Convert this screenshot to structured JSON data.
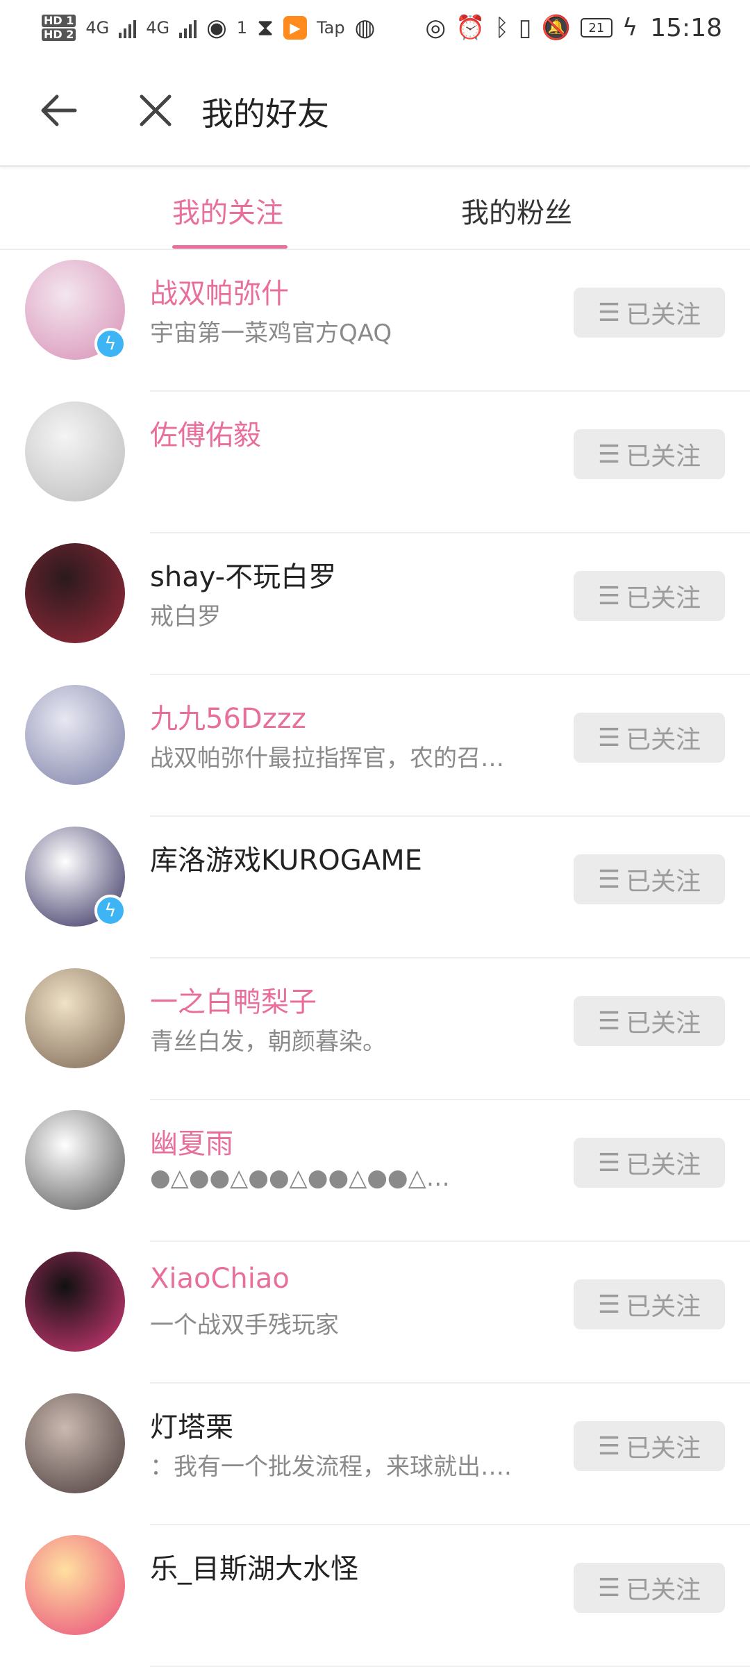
{
  "status_bar": {
    "hd1": "HD 1",
    "hd2": "HD 2",
    "net1": "4G",
    "net2": "4G",
    "wifi_num": "1",
    "tap_label": "Tap",
    "battery": "21",
    "time": "15:18"
  },
  "header": {
    "title": "我的好友"
  },
  "tabs": [
    {
      "label": "我的关注"
    },
    {
      "label": "我的粉丝"
    }
  ],
  "follow_label": "已关注",
  "friends": [
    {
      "name": "战双帕弥什",
      "sub": "宇宙第一菜鸡官方QAQ",
      "name_color": "pink",
      "verified": true,
      "avatar_colors": [
        "#f3e6ef",
        "#d88fb5"
      ]
    },
    {
      "name": "佐傅佑毅",
      "sub": "",
      "name_color": "pink",
      "verified": false,
      "avatar_colors": [
        "#f4f4f4",
        "#bcbcbc"
      ]
    },
    {
      "name": "shay-不玩白罗",
      "sub": "戒白罗",
      "name_color": "dark",
      "verified": false,
      "avatar_colors": [
        "#2a1a1e",
        "#9a2a3a"
      ]
    },
    {
      "name": "九九56Dzzz",
      "sub": "战双帕弥什最拉指挥官，农的召…",
      "name_color": "pink",
      "verified": false,
      "avatar_colors": [
        "#e8e8f2",
        "#7b7fa6"
      ]
    },
    {
      "name": "库洛游戏KUROGAME",
      "sub": "",
      "name_color": "dark",
      "verified": true,
      "avatar_colors": [
        "#ffffff",
        "#2f2a5c"
      ]
    },
    {
      "name": "一之白鸭梨子",
      "sub": "青丝白发，朝颜暮染。",
      "name_color": "pink",
      "verified": false,
      "avatar_colors": [
        "#efe2c6",
        "#7a6452"
      ]
    },
    {
      "name": "幽夏雨",
      "sub": "●△●●△●●△●●△●●△…",
      "name_color": "pink",
      "verified": false,
      "avatar_colors": [
        "#ffffff",
        "#555555"
      ]
    },
    {
      "name": "XiaoChiao",
      "sub": "一个战双手残玩家",
      "name_color": "pink",
      "verified": false,
      "avatar_colors": [
        "#111111",
        "#d83a7a"
      ]
    },
    {
      "name": "灯塔栗",
      "sub": "：我有一个批发流程，来球就出….",
      "name_color": "dark",
      "verified": false,
      "avatar_colors": [
        "#c9b9b0",
        "#4a3a3a"
      ]
    },
    {
      "name": "乐_目斯湖大水怪",
      "sub": "",
      "name_color": "dark",
      "verified": false,
      "avatar_colors": [
        "#ffe0a0",
        "#e84a7a"
      ]
    }
  ],
  "colors": {
    "accent": "#e86f9b",
    "verified": "#3db4f4",
    "follow_bg": "#ebebeb"
  }
}
